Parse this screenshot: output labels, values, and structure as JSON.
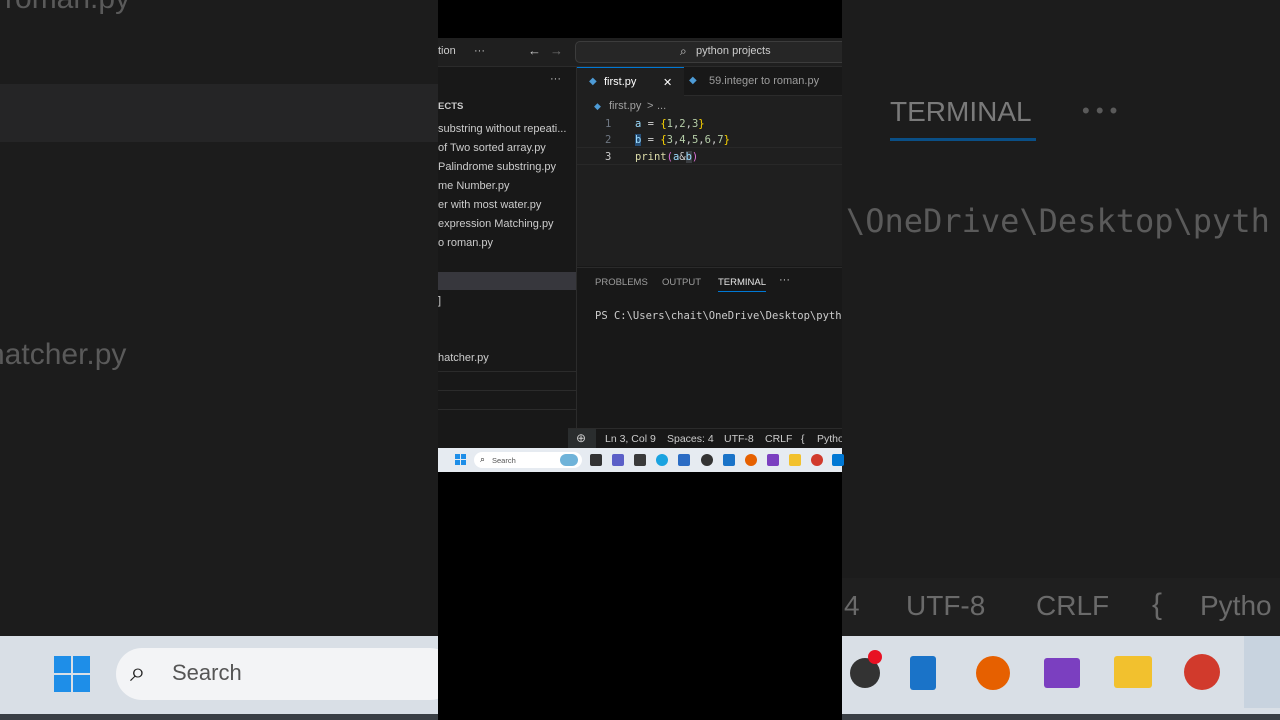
{
  "window": {
    "title_fragment": "tion",
    "more_glyph": "···",
    "back_glyph": "←",
    "forward_glyph": "→",
    "search_label": "python projects"
  },
  "sidebar": {
    "more_glyph": "···",
    "section_header": "ECTS",
    "items": [
      {
        "label": "substring without repeati..."
      },
      {
        "label": "of Two sorted array.py"
      },
      {
        "label": " Palindrome substring.py"
      },
      {
        "label": "me Number.py"
      },
      {
        "label": "er with most water.py"
      },
      {
        "label": "expression Matching.py"
      },
      {
        "label": "o roman.py"
      }
    ],
    "below_items": [
      {
        "label": "]"
      },
      {
        "label": "hatcher.py"
      }
    ]
  },
  "tabs": [
    {
      "label": "first.py",
      "active": true,
      "close_glyph": "✕"
    },
    {
      "label": "59.integer to roman.py",
      "active": false
    }
  ],
  "breadcrumb": {
    "file": "first.py",
    "sep": ">",
    "more": "..."
  },
  "editor": {
    "lines": [
      {
        "num": "1",
        "code": "a = {1,2,3}"
      },
      {
        "num": "2",
        "code": "b = {3,4,5,6,7}"
      },
      {
        "num": "3",
        "code": "print(a&b)"
      }
    ]
  },
  "panel": {
    "tabs": [
      "PROBLEMS",
      "OUTPUT",
      "TERMINAL"
    ],
    "active_tab": "TERMINAL",
    "more_glyph": "···",
    "terminal_line": "PS C:\\Users\\chait\\OneDrive\\Desktop\\pyth"
  },
  "statusbar": {
    "position": "Ln 3, Col 9",
    "spaces": "Spaces: 4",
    "encoding": "UTF-8",
    "eol": "CRLF",
    "brace_glyph": "{",
    "language": "Pytho"
  },
  "taskbar": {
    "search_label": "Search"
  },
  "background": {
    "left_title": "o roman.py",
    "left_partial": "]",
    "left_file": "hatcher.py",
    "left_search": "Search",
    "right_terminal_tab": "TERMINAL",
    "right_more": "• • •",
    "right_path": "\\OneDrive\\Desktop\\pyth",
    "right_status": [
      "4",
      "UTF-8",
      "CRLF",
      "{",
      "Pytho"
    ]
  },
  "colors": {
    "accent": "#0078d4",
    "editor_bg": "#1f1f1f",
    "keyword_var": "#9cdcfe",
    "brace": "#ffd700",
    "number": "#b5cea8",
    "function": "#dcdcaa"
  }
}
